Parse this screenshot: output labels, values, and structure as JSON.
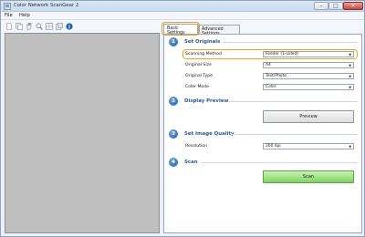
{
  "window": {
    "title": "Color Network ScanGear 2",
    "controls": {
      "minimize": "–",
      "maximize": "□",
      "close": "✕"
    }
  },
  "menu": [
    {
      "label": "File"
    },
    {
      "label": "Help"
    }
  ],
  "toolbar": {
    "icons": [
      "new-document-icon",
      "duplicate-icon",
      "hand-icon",
      "zoom-icon",
      "grid-icon",
      "copy-icon",
      "info-icon"
    ]
  },
  "tabs": [
    {
      "label": "Basic Settings",
      "active": true
    },
    {
      "label": "Advanced Settings",
      "active": false
    }
  ],
  "sections": {
    "originals": {
      "number": "1",
      "title": "Set Originals",
      "fields": [
        {
          "label": "Scanning Method",
          "value": "Feeder (1-sided)"
        },
        {
          "label": "Original Size",
          "value": "A4"
        },
        {
          "label": "Original Type",
          "value": "Text/Photo"
        },
        {
          "label": "Color Mode",
          "value": "Color"
        }
      ]
    },
    "preview": {
      "number": "2",
      "title": "Display Preview",
      "button": "Preview"
    },
    "quality": {
      "number": "3",
      "title": "Set Image Quality",
      "fields": [
        {
          "label": "Resolution",
          "value": "200 dpi"
        }
      ]
    },
    "scan": {
      "number": "4",
      "title": "Scan",
      "button": "Scan"
    }
  },
  "colors": {
    "accent": "#f2a21b",
    "section": "#2a5a98",
    "scan_button": "#7fd561",
    "preview_area": "#bfbfbf"
  }
}
